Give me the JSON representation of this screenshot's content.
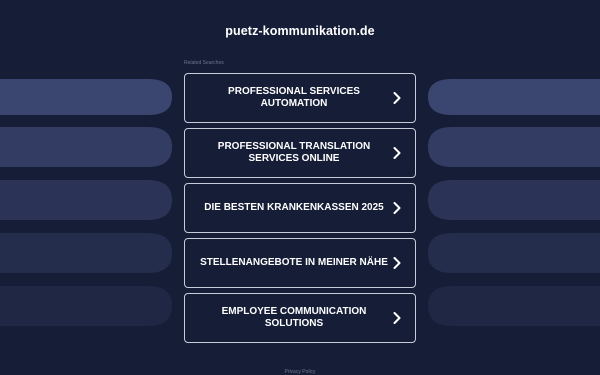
{
  "site": {
    "title": "puetz-kommunikation.de"
  },
  "related": {
    "label": "Related Searches",
    "items": [
      {
        "label": "PROFESSIONAL SERVICES AUTOMATION"
      },
      {
        "label": "PROFESSIONAL TRANSLATION SERVICES ONLINE"
      },
      {
        "label": "DIE BESTEN KRANKENKASSEN 2025"
      },
      {
        "label": "STELLENANGEBOTE IN MEINER NÄHE"
      },
      {
        "label": "EMPLOYEE COMMUNICATION SOLUTIONS"
      }
    ]
  },
  "footer": {
    "privacy": "Privacy Policy"
  },
  "icons": {
    "chevron": "chevron-right-icon"
  },
  "colors": {
    "background": "#161d37",
    "card_border": "#c7ccd9",
    "text": "#ffffff",
    "muted_text": "#6e7694"
  }
}
